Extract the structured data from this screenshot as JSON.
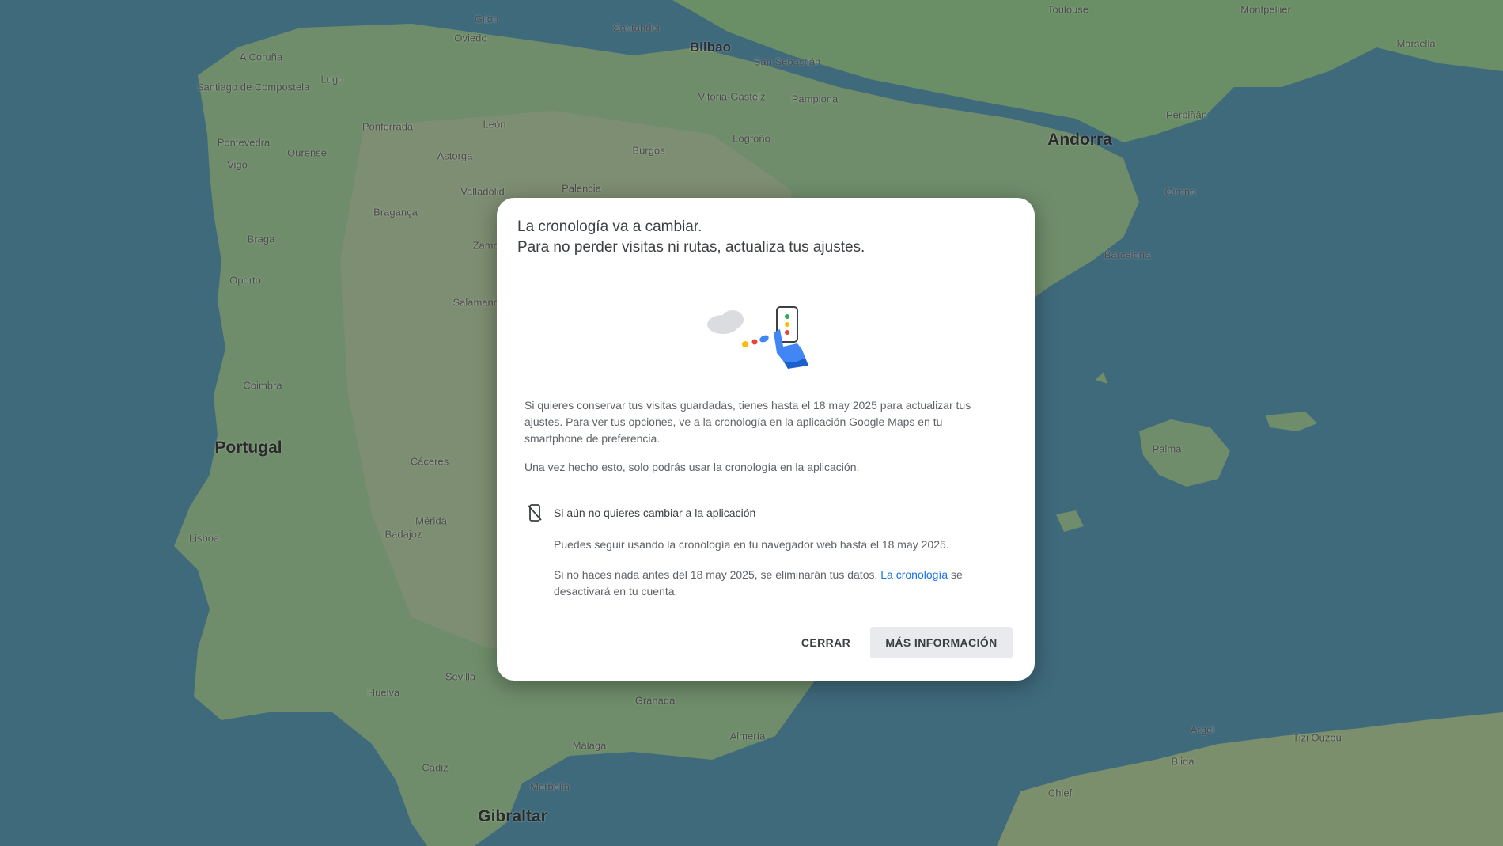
{
  "map": {
    "labels": [
      {
        "name": "A Coruña",
        "size": "small"
      },
      {
        "name": "Santiago de Compostela",
        "size": "small"
      },
      {
        "name": "Lugo",
        "size": "small"
      },
      {
        "name": "Oviedo",
        "size": "small"
      },
      {
        "name": "Gijón",
        "size": "small"
      },
      {
        "name": "Santander",
        "size": "small"
      },
      {
        "name": "Bilbao",
        "size": "mid"
      },
      {
        "name": "San Sebastián",
        "size": "small"
      },
      {
        "name": "Vitoria-Gasteiz",
        "size": "small"
      },
      {
        "name": "Pamplona",
        "size": "small"
      },
      {
        "name": "Logroño",
        "size": "small"
      },
      {
        "name": "Burgos",
        "size": "small"
      },
      {
        "name": "Ponferrada",
        "size": "small"
      },
      {
        "name": "León",
        "size": "small"
      },
      {
        "name": "Pontevedra",
        "size": "small"
      },
      {
        "name": "Vigo",
        "size": "small"
      },
      {
        "name": "Ourense",
        "size": "small"
      },
      {
        "name": "Astorga",
        "size": "small"
      },
      {
        "name": "Palencia",
        "size": "small"
      },
      {
        "name": "Valladolid",
        "size": "small"
      },
      {
        "name": "Braga",
        "size": "small"
      },
      {
        "name": "Oporto",
        "size": "small"
      },
      {
        "name": "Bragança",
        "size": "small"
      },
      {
        "name": "Zamora",
        "size": "small"
      },
      {
        "name": "Salamanca",
        "size": "small"
      },
      {
        "name": "Coimbra",
        "size": "small"
      },
      {
        "name": "Portugal",
        "size": "big"
      },
      {
        "name": "Lisboa",
        "size": "small"
      },
      {
        "name": "Cáceres",
        "size": "small"
      },
      {
        "name": "Badajoz",
        "size": "small"
      },
      {
        "name": "Mérida",
        "size": "small"
      },
      {
        "name": "Sevilla",
        "size": "small"
      },
      {
        "name": "Huelva",
        "size": "small"
      },
      {
        "name": "Cádiz",
        "size": "small"
      },
      {
        "name": "Málaga",
        "size": "small"
      },
      {
        "name": "Granada",
        "size": "small"
      },
      {
        "name": "Almería",
        "size": "small"
      },
      {
        "name": "Gibraltar",
        "size": "big"
      },
      {
        "name": "Marbella",
        "size": "small"
      },
      {
        "name": "Toulouse",
        "size": "small"
      },
      {
        "name": "Montpellier",
        "size": "small"
      },
      {
        "name": "Marsella",
        "size": "small"
      },
      {
        "name": "Perpiñán",
        "size": "small"
      },
      {
        "name": "Andorra",
        "size": "big"
      },
      {
        "name": "Girona",
        "size": "small"
      },
      {
        "name": "Barcelona",
        "size": "small"
      },
      {
        "name": "Palma",
        "size": "small"
      },
      {
        "name": "Argel",
        "size": "small"
      },
      {
        "name": "Tizi Ouzou",
        "size": "small"
      },
      {
        "name": "Blida",
        "size": "small"
      },
      {
        "name": "Chlef",
        "size": "small"
      }
    ]
  },
  "dialog": {
    "title_line1": "La cronología va a cambiar.",
    "title_line2": "Para no perder visitas ni rutas, actualiza tus ajustes.",
    "illustration_icon": "cloud-phone-illustration",
    "paragraph1": "Si quieres conservar tus visitas guardadas, tienes hasta el 18 may 2025 para actualizar tus ajustes. Para ver tus opciones, ve a la cronología en la aplicación Google Maps en tu smartphone de preferencia.",
    "paragraph2": "Una vez hecho esto, solo podrás usar la cronología en la aplicación.",
    "notice_icon": "phone-off-icon",
    "notice_title": "Si aún no quieres cambiar a la aplicación",
    "notice_text1": "Puedes seguir usando la cronología en tu navegador web hasta el 18 may 2025.",
    "notice_text2_prefix": "Si no haces nada antes del 18 may 2025, se eliminarán tus datos.",
    "notice_text2_link": "La cronología",
    "notice_text2_suffix": "se desactivará en tu cuenta.",
    "close_button": "CERRAR",
    "more_button": "MÁS INFORMACIÓN"
  },
  "colors": {
    "sea": "#3f6a7c",
    "land": "#6e8f6a",
    "dialog_bg": "#ffffff",
    "link": "#1a73e8",
    "button_bg": "#e8eaed"
  }
}
